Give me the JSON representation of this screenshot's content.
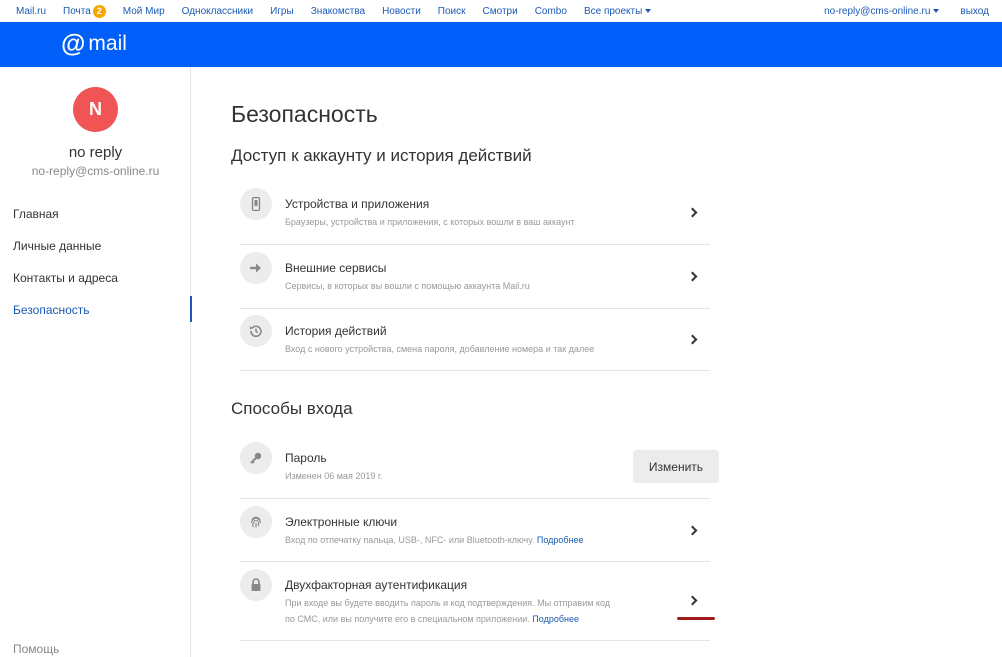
{
  "topbar": {
    "links": [
      "Mail.ru",
      "Почта",
      "Мой Мир",
      "Одноклассники",
      "Игры",
      "Знакомства",
      "Новости",
      "Поиск",
      "Смотри",
      "Combo",
      "Все проекты"
    ],
    "mail_badge": "2",
    "account": "no-reply@cms-online.ru",
    "logout": "выход"
  },
  "header": {
    "logo_at": "@",
    "logo_word": "mail"
  },
  "profile": {
    "initial": "N",
    "name": "no reply",
    "email": "no-reply@cms-online.ru"
  },
  "sidebar": {
    "items": [
      {
        "label": "Главная"
      },
      {
        "label": "Личные данные"
      },
      {
        "label": "Контакты и адреса"
      },
      {
        "label": "Безопасность",
        "active": true
      }
    ],
    "help": "Помощь"
  },
  "main": {
    "title": "Безопасность",
    "access_section": {
      "title": "Доступ к аккаунту и история действий",
      "rows": [
        {
          "title": "Устройства и приложения",
          "desc": "Браузеры, устройства и приложения, с которых вошли в ваш аккаунт",
          "icon": "phone-icon"
        },
        {
          "title": "Внешние сервисы",
          "desc": "Сервисы, в которых вы вошли с помощью аккаунта Mail.ru",
          "icon": "arrow-right-icon"
        },
        {
          "title": "История действий",
          "desc": "Вход с нового устройства, смена пароля, добавление номера и так далее",
          "icon": "history-icon"
        }
      ]
    },
    "login_section": {
      "title": "Способы входа",
      "password": {
        "title": "Пароль",
        "desc": "Изменен 06 мая 2019 г.",
        "button": "Изменить",
        "icon": "key-icon"
      },
      "keys": {
        "title": "Электронные ключи",
        "desc": "Вход по отпечатку пальца, USB-, NFC- или Bluetooth-ключу.",
        "more": "Подробнее",
        "icon": "fingerprint-icon"
      },
      "twofa": {
        "title": "Двухфакторная аутентификация",
        "desc_line1": "При входе вы будете вводить пароль и код подтверждения. Мы отправим код",
        "desc_line2": "по СМС, или вы получите его в специальном приложении.",
        "more": "Подробнее",
        "icon": "lock-icon"
      }
    }
  },
  "colors": {
    "brand": "#005ff9",
    "link": "#1a5ab6",
    "avatar": "#f05454",
    "badge": "#f7a600",
    "annotation": "#a01c1c"
  }
}
